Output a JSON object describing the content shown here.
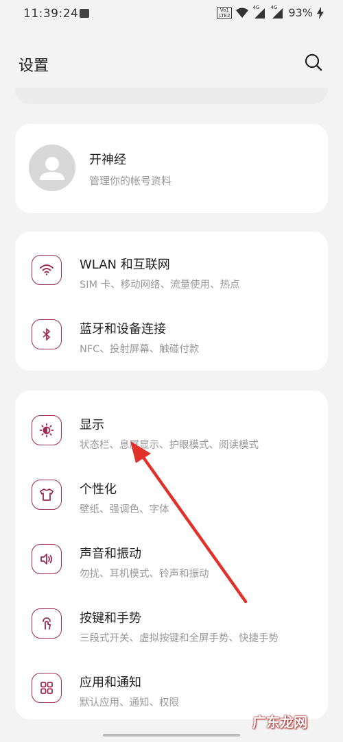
{
  "status": {
    "time": "11:39:24",
    "volte_top": "Vo1",
    "volte_bottom": "LTE2",
    "net_label_1": "4G",
    "net_label_2": "4G",
    "battery": "93%"
  },
  "header": {
    "title": "设置"
  },
  "account": {
    "name": "开神经",
    "subtitle": "管理你的帐号资料"
  },
  "sections": [
    {
      "items": [
        {
          "title": "WLAN 和互联网",
          "subtitle": "SIM 卡、移动网络、流量使用、热点",
          "icon": "wifi-icon"
        },
        {
          "title": "蓝牙和设备连接",
          "subtitle": "NFC、投射屏幕、触碰付款",
          "icon": "bluetooth-icon"
        }
      ]
    },
    {
      "items": [
        {
          "title": "显示",
          "subtitle": "状态栏、息屏显示、护眼模式、阅读模式",
          "icon": "brightness-icon"
        },
        {
          "title": "个性化",
          "subtitle": "壁纸、强调色、字体",
          "icon": "tshirt-icon"
        },
        {
          "title": "声音和振动",
          "subtitle": "勿扰、耳机模式、铃声和振动",
          "icon": "speaker-icon"
        },
        {
          "title": "按键和手势",
          "subtitle": "三段式开关、虚拟按键和全屏手势、快捷手势",
          "icon": "touch-gesture-icon"
        },
        {
          "title": "应用和通知",
          "subtitle": "默认应用、通知、权限",
          "icon": "apps-grid-icon"
        }
      ]
    }
  ],
  "watermark": "广东龙网",
  "colors": {
    "accent": "#9c2b52",
    "annotation_arrow": "#e0322b"
  }
}
